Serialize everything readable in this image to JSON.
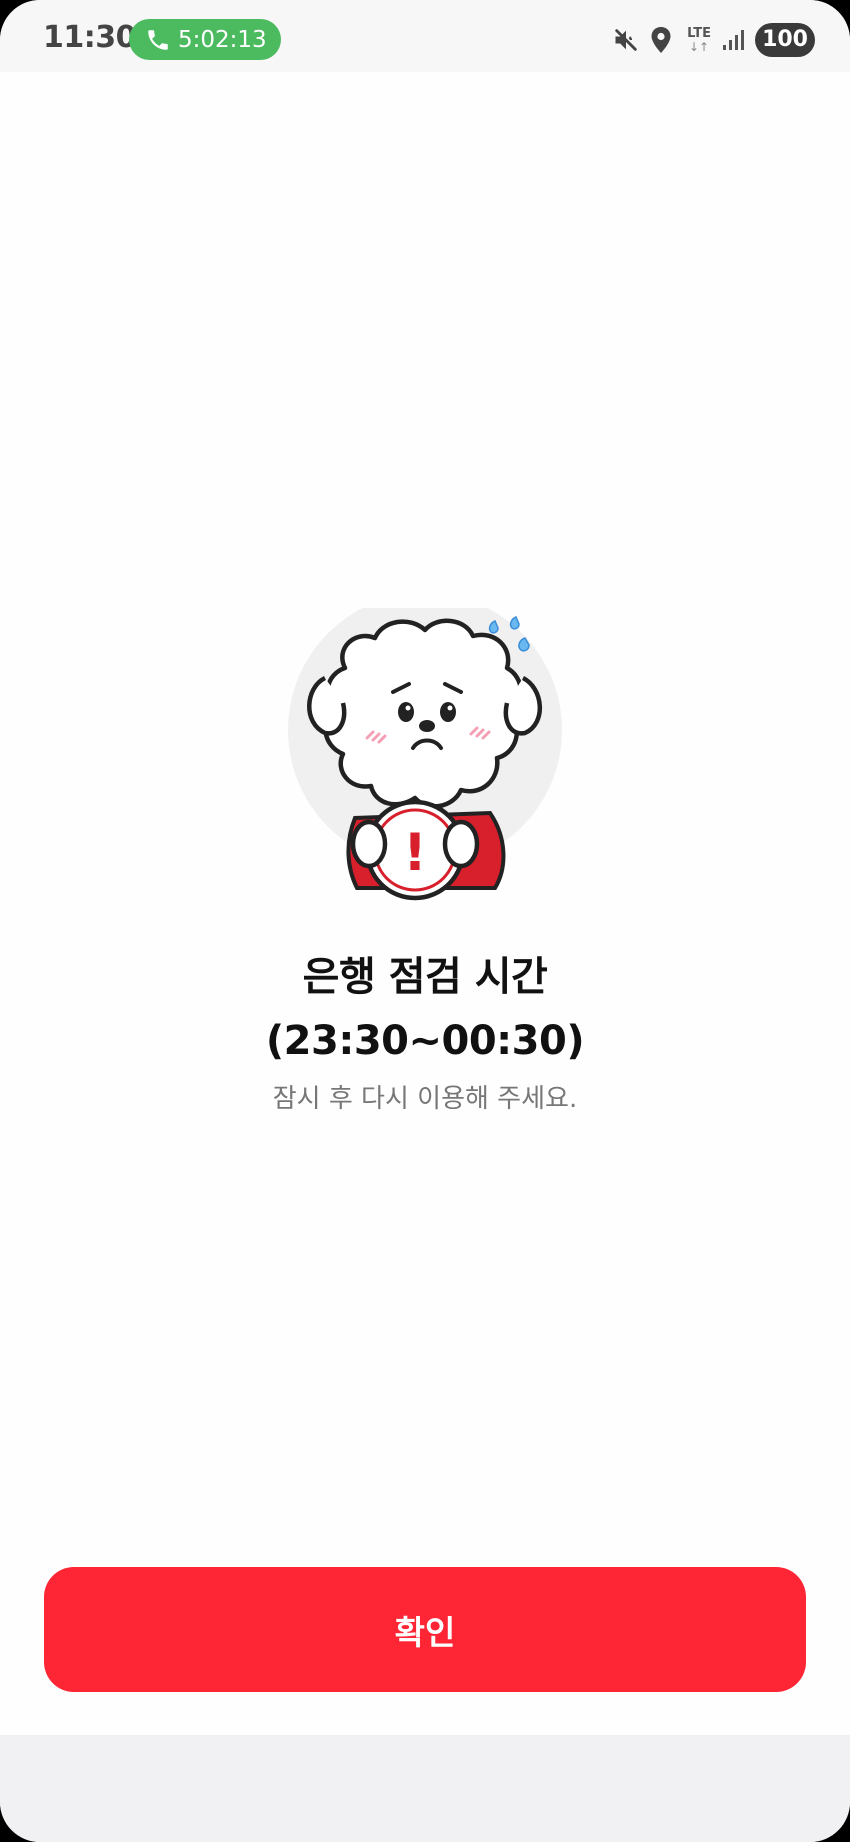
{
  "status_bar": {
    "time": "11:30",
    "call_timer": "5:02:13",
    "network": "LTE",
    "network_arrows": "↓↑",
    "battery": "100",
    "icons": [
      "phone-icon",
      "mute-icon",
      "location-icon",
      "lte-icon",
      "signal-icon",
      "battery-icon"
    ]
  },
  "notice": {
    "title_line1": "은행 점검 시간",
    "title_line2": "(23:30~00:30)",
    "subtitle": "잠시 후 다시 이용해 주세요.",
    "illustration": "worried-dog-holding-warning-sign",
    "warning_mark": "!"
  },
  "actions": {
    "confirm_label": "확인"
  },
  "colors": {
    "accent": "#fe2535",
    "call_pill": "#4cbb5f",
    "title_text": "#111111",
    "subtitle_text": "#777777",
    "illustration_bg": "#f0f0f0"
  }
}
